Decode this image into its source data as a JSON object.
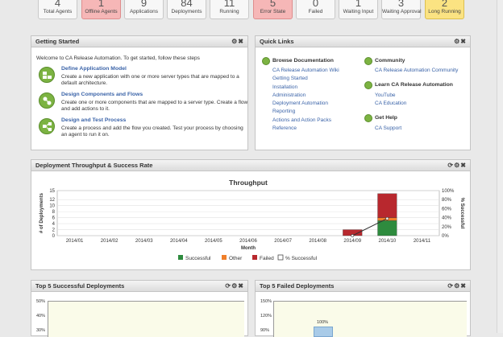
{
  "status_tiles": [
    {
      "value": "4",
      "label": "Total Agents",
      "style": "normal"
    },
    {
      "value": "1",
      "label": "Offline Agents",
      "style": "red"
    },
    {
      "value": "9",
      "label": "Applications",
      "style": "normal"
    },
    {
      "value": "84",
      "label": "Deployments",
      "style": "normal"
    },
    {
      "value": "11",
      "label": "Running",
      "style": "normal"
    },
    {
      "value": "5",
      "label": "Error State",
      "style": "red"
    },
    {
      "value": "0",
      "label": "Failed",
      "style": "normal"
    },
    {
      "value": "1",
      "label": "Waiting Input",
      "style": "normal"
    },
    {
      "value": "3",
      "label": "Waiting Approval",
      "style": "normal"
    },
    {
      "value": "2",
      "label": "Long Running",
      "style": "yellow"
    }
  ],
  "getting_started": {
    "title": "Getting Started",
    "intro": "Welcome to CA Release Automation. To get started, follow these steps",
    "items": [
      {
        "title": "Define Application Model",
        "desc": "Create a new application with one or more server types that are mapped to a default architecture."
      },
      {
        "title": "Design Components and Flows",
        "desc": "Create one or more components that are mapped to a server type. Create a flow and add actions to it."
      },
      {
        "title": "Design and Test Process",
        "desc": "Create a process and add the flow you created. Test your process by choosing an agent to run it on."
      }
    ]
  },
  "quick_links": {
    "title": "Quick Links",
    "browse": {
      "heading": "Browse Documentation",
      "links": [
        "CA Release Automation Wiki",
        "Getting Started",
        "Installation",
        "Administration",
        "Deployment Automation",
        "Reporting",
        "Actions and Action Packs",
        "Reference"
      ]
    },
    "community": {
      "heading": "Community",
      "links": [
        "CA Release Automation Community"
      ]
    },
    "learn": {
      "heading": "Learn CA Release Automation",
      "links": [
        "YouTube",
        "CA Education"
      ]
    },
    "help": {
      "heading": "Get Help",
      "links": [
        "CA Support"
      ]
    }
  },
  "throughput": {
    "title": "Deployment Throughput & Success Rate",
    "chart_title": "Throughput",
    "xlabel": "Month",
    "ylabel": "# of Deployments",
    "y2label": "% Successful",
    "legend": [
      "Successful",
      "Other",
      "Failed",
      "% Successful"
    ]
  },
  "chart_data": {
    "type": "bar",
    "stacked": true,
    "title": "Throughput",
    "xlabel": "Month",
    "ylabel": "# of Deployments",
    "y2label": "% Successful",
    "categories": [
      "2014/01",
      "2014/02",
      "2014/03",
      "2014/04",
      "2014/05",
      "2014/06",
      "2014/07",
      "2014/08",
      "2014/09",
      "2014/10",
      "2014/11"
    ],
    "yticks": [
      "0",
      "2",
      "4",
      "6",
      "8",
      "10",
      "12",
      "15"
    ],
    "y2ticks": [
      "0%",
      "20%",
      "40%",
      "60%",
      "80%",
      "100%"
    ],
    "ylim": [
      0,
      15
    ],
    "y2lim": [
      0,
      100
    ],
    "series": [
      {
        "name": "Successful",
        "color": "#2e8b3e",
        "values": [
          0,
          0,
          0,
          0,
          0,
          0,
          0,
          0,
          0,
          5,
          0
        ]
      },
      {
        "name": "Other",
        "color": "#f07f2a",
        "values": [
          0,
          0,
          0,
          0,
          0,
          0,
          0,
          0,
          0,
          1,
          0
        ]
      },
      {
        "name": "Failed",
        "color": "#b8282e",
        "values": [
          0,
          0,
          0,
          0,
          0,
          0,
          0,
          0,
          2,
          8,
          0
        ]
      }
    ],
    "line": {
      "name": "% Successful",
      "values": [
        null,
        null,
        null,
        null,
        null,
        null,
        null,
        null,
        0,
        38,
        null
      ]
    },
    "grid": true,
    "legend_position": "bottom"
  },
  "top5_success": {
    "title": "Top 5 Successful Deployments",
    "yticks": [
      "50%",
      "40%",
      "30%"
    ]
  },
  "top5_failed": {
    "title": "Top 5 Failed Deployments",
    "yticks": [
      "150%",
      "120%",
      "90%"
    ],
    "bar_label": "100%"
  },
  "colors": {
    "accent_green": "#7cb342",
    "link_blue": "#3a63a8",
    "tile_red": "#f6b7b7",
    "tile_yellow": "#fbe382"
  }
}
